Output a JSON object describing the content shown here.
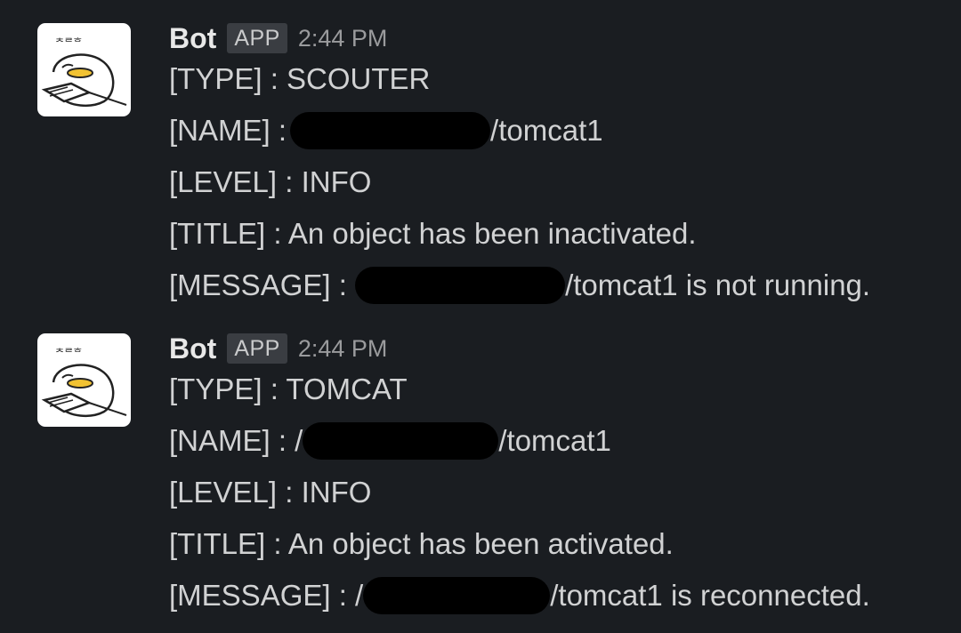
{
  "messages": [
    {
      "bot_name": "Bot",
      "badge": "APP",
      "time": "2:44 PM",
      "avatar_icon": "cartoon-bot-avatar",
      "lines": {
        "type": "[TYPE] : SCOUTER",
        "name_prefix": "[NAME] :",
        "name_suffix": "/tomcat1",
        "level": "[LEVEL] : INFO",
        "title": "[TITLE] : An object has been inactivated.",
        "message_prefix": "[MESSAGE] :",
        "message_suffix": "/tomcat1 is not running."
      }
    },
    {
      "bot_name": "Bot",
      "badge": "APP",
      "time": "2:44 PM",
      "avatar_icon": "cartoon-bot-avatar",
      "lines": {
        "type": "[TYPE] : TOMCAT",
        "name_prefix": "[NAME] : /",
        "name_suffix": "/tomcat1",
        "level": "[LEVEL] : INFO",
        "title": "[TITLE] : An object has been activated.",
        "message_prefix": "[MESSAGE] : /",
        "message_suffix": "/tomcat1 is reconnected."
      }
    }
  ],
  "colors": {
    "background": "#1a1d21",
    "text": "#d1d2d3",
    "badge_bg": "#3a3d42",
    "timestamp": "#9a9b9d"
  }
}
